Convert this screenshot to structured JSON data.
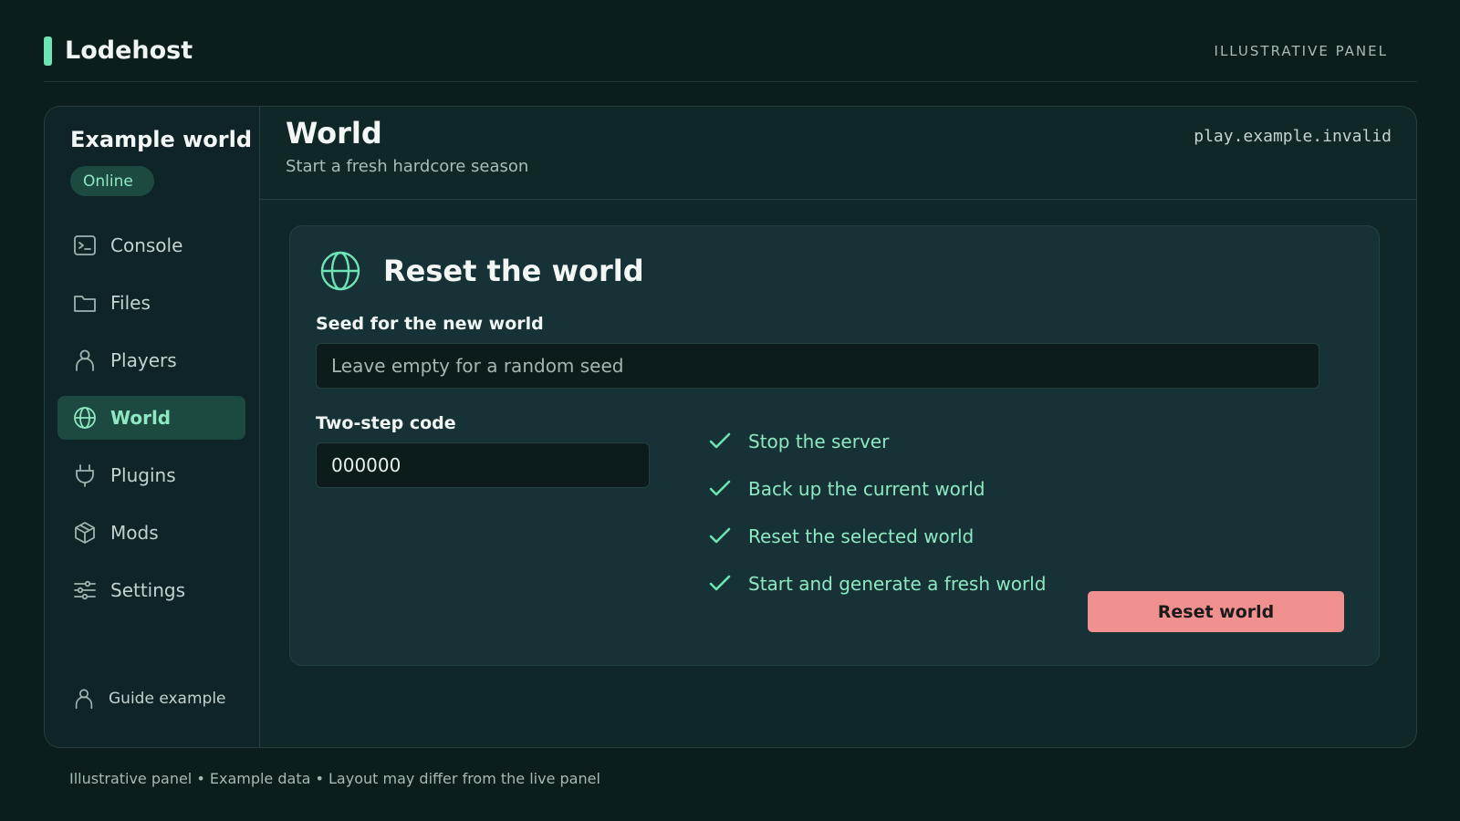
{
  "brand": {
    "name": "Lodehost",
    "tag": "ILLUSTRATIVE PANEL"
  },
  "server": {
    "name": "Example world",
    "status": "Online",
    "host": "play.example.invalid"
  },
  "sidebar": {
    "items": [
      {
        "label": "Console",
        "icon": "terminal-icon"
      },
      {
        "label": "Files",
        "icon": "folder-icon"
      },
      {
        "label": "Players",
        "icon": "user-icon"
      },
      {
        "label": "World",
        "icon": "globe-icon",
        "active": true
      },
      {
        "label": "Plugins",
        "icon": "plug-icon"
      },
      {
        "label": "Mods",
        "icon": "cube-icon"
      },
      {
        "label": "Settings",
        "icon": "sliders-icon"
      }
    ],
    "user": "Guide example"
  },
  "page": {
    "title": "World",
    "subtitle": "Start a fresh hardcore season"
  },
  "reset_card": {
    "title": "Reset the world",
    "icon": "globe-icon",
    "seed_label": "Seed for the new world",
    "seed_placeholder": "Leave empty for a random seed",
    "seed_value": "",
    "code_label": "Two-step code",
    "code_value": "000000",
    "steps": [
      "Stop the server",
      "Back up the current world",
      "Reset the selected world",
      "Start and generate a fresh world"
    ],
    "button_label": "Reset world"
  },
  "footer": "Illustrative panel • Example data • Layout may differ from the live panel",
  "colors": {
    "accent": "#6ee3b4",
    "danger": "#f0908f",
    "background": "#0c1d1e"
  }
}
